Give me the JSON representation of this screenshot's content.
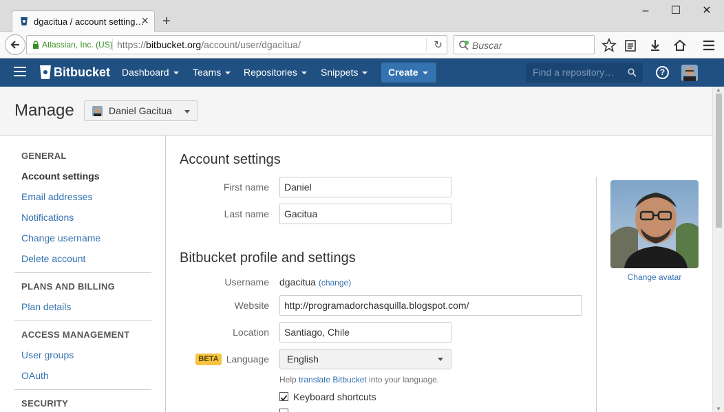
{
  "browser": {
    "tab_title": "dgacitua / account setting…",
    "site_identity": "Atlassian, Inc. (US)",
    "url_prefix": "https://",
    "url_domain": "bitbucket.org",
    "url_path": "/account/user/dgacitua/",
    "search_placeholder": "Buscar"
  },
  "header": {
    "brand": "Bitbucket",
    "nav": [
      "Dashboard",
      "Teams",
      "Repositories",
      "Snippets"
    ],
    "create_label": "Create",
    "search_placeholder": "Find a repository…",
    "help_label": "?"
  },
  "page": {
    "title": "Manage",
    "user_selector": "Daniel Gacitua"
  },
  "sidebar": {
    "general_heading": "GENERAL",
    "general_items": [
      "Account settings",
      "Email addresses",
      "Notifications",
      "Change username",
      "Delete account"
    ],
    "plans_heading": "PLANS AND BILLING",
    "plans_items": [
      "Plan details"
    ],
    "access_heading": "ACCESS MANAGEMENT",
    "access_items": [
      "User groups",
      "OAuth"
    ],
    "security_heading": "SECURITY"
  },
  "account": {
    "heading": "Account settings",
    "first_name_label": "First name",
    "first_name_value": "Daniel",
    "last_name_label": "Last name",
    "last_name_value": "Gacitua"
  },
  "profile": {
    "heading": "Bitbucket profile and settings",
    "username_label": "Username",
    "username_value": "dgacitua",
    "change_link": "(change)",
    "website_label": "Website",
    "website_value": "http://programadorchasquilla.blogspot.com/",
    "location_label": "Location",
    "location_value": "Santiago, Chile",
    "beta_badge": "BETA",
    "language_label": "Language",
    "language_value": "English",
    "help_prefix": "Help ",
    "help_link": "translate Bitbucket",
    "help_suffix": " into your language.",
    "keyboard_label": "Keyboard shortcuts",
    "keyboard_checked": true,
    "change_avatar": "Change avatar"
  }
}
